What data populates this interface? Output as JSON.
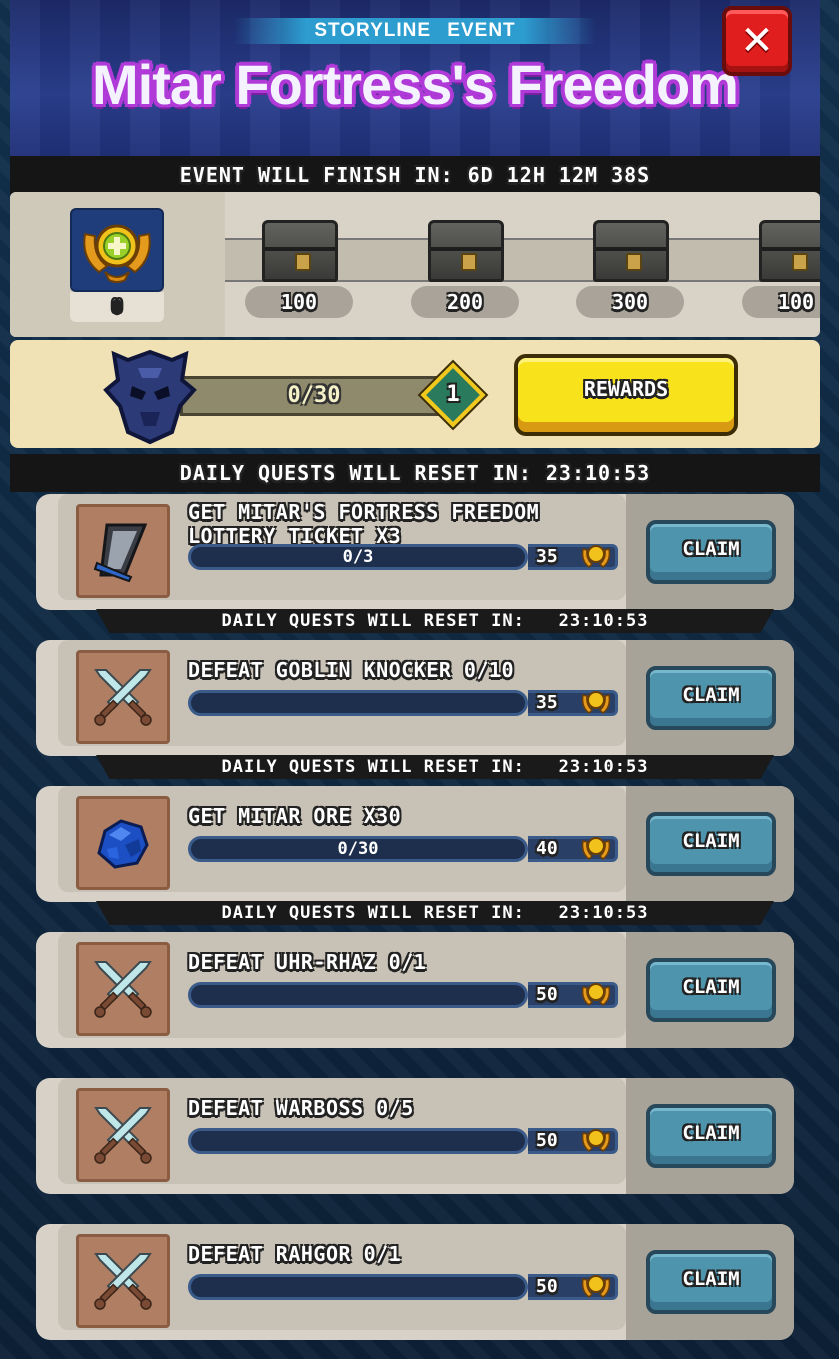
{
  "header": {
    "subtitle": "STORYLINE   EVENT",
    "title": "Mitar Fortress's Freedom",
    "close_icon": "close-x-icon"
  },
  "event_timer": {
    "label": "EVENT WILL FINISH IN:",
    "value": "6D 12H 12M 38S"
  },
  "milestones": {
    "points_icon": "gold-laurel-plus-icon",
    "points_value": "0",
    "chests": [
      {
        "label": "100",
        "icon": "chest-icon"
      },
      {
        "label": "200",
        "icon": "chest-icon"
      },
      {
        "label": "300",
        "icon": "chest-icon"
      },
      {
        "label": "100",
        "icon": "chest-icon"
      }
    ]
  },
  "progress": {
    "boss_icon": "dark-knight-helmet-icon",
    "text": "0/30",
    "current": 0,
    "max": 30,
    "level": "1",
    "rewards_label": "REWARDS"
  },
  "daily_timer": {
    "label": "DAILY QUESTS WILL RESET IN:",
    "value": "23:10:53"
  },
  "quests": [
    {
      "title": "GET MITAR'S FORTRESS FREEDOM LOTTERY TICKET X3",
      "progress_text": "0/3",
      "progress": 0,
      "reward": "35",
      "icon": "lottery-ticket-icon",
      "claim": "CLAIM"
    },
    {
      "title": "DEFEAT GOBLIN KNOCKER 0/10",
      "progress_text": "",
      "progress": 0,
      "reward": "35",
      "icon": "crossed-swords-icon",
      "claim": "CLAIM"
    },
    {
      "title": "GET MITAR ORE X30",
      "progress_text": "0/30",
      "progress": 0,
      "reward": "40",
      "icon": "mitar-ore-icon",
      "claim": "CLAIM"
    },
    {
      "title": "DEFEAT UHR-RHAZ 0/1",
      "progress_text": "",
      "progress": 0,
      "reward": "50",
      "icon": "crossed-swords-icon",
      "claim": "CLAIM"
    },
    {
      "title": "DEFEAT WARBOSS 0/5",
      "progress_text": "",
      "progress": 0,
      "reward": "50",
      "icon": "crossed-swords-icon",
      "claim": "CLAIM"
    },
    {
      "title": "DEFEAT RAHGOR 0/1",
      "progress_text": "",
      "progress": 0,
      "reward": "50",
      "icon": "crossed-swords-icon",
      "claim": "CLAIM"
    }
  ],
  "reset_strips": [
    {
      "label": "DAILY QUESTS WILL RESET IN:",
      "value": "23:10:53"
    },
    {
      "label": "DAILY QUESTS WILL RESET IN:",
      "value": "23:10:53"
    },
    {
      "label": "DAILY QUESTS WILL RESET IN:",
      "value": "23:10:53"
    }
  ],
  "colors": {
    "title_outline": "#b03ad8",
    "close_button": "#e01e1e",
    "rewards_button": "#f7e21c",
    "claim_button": "#4e94ad"
  }
}
